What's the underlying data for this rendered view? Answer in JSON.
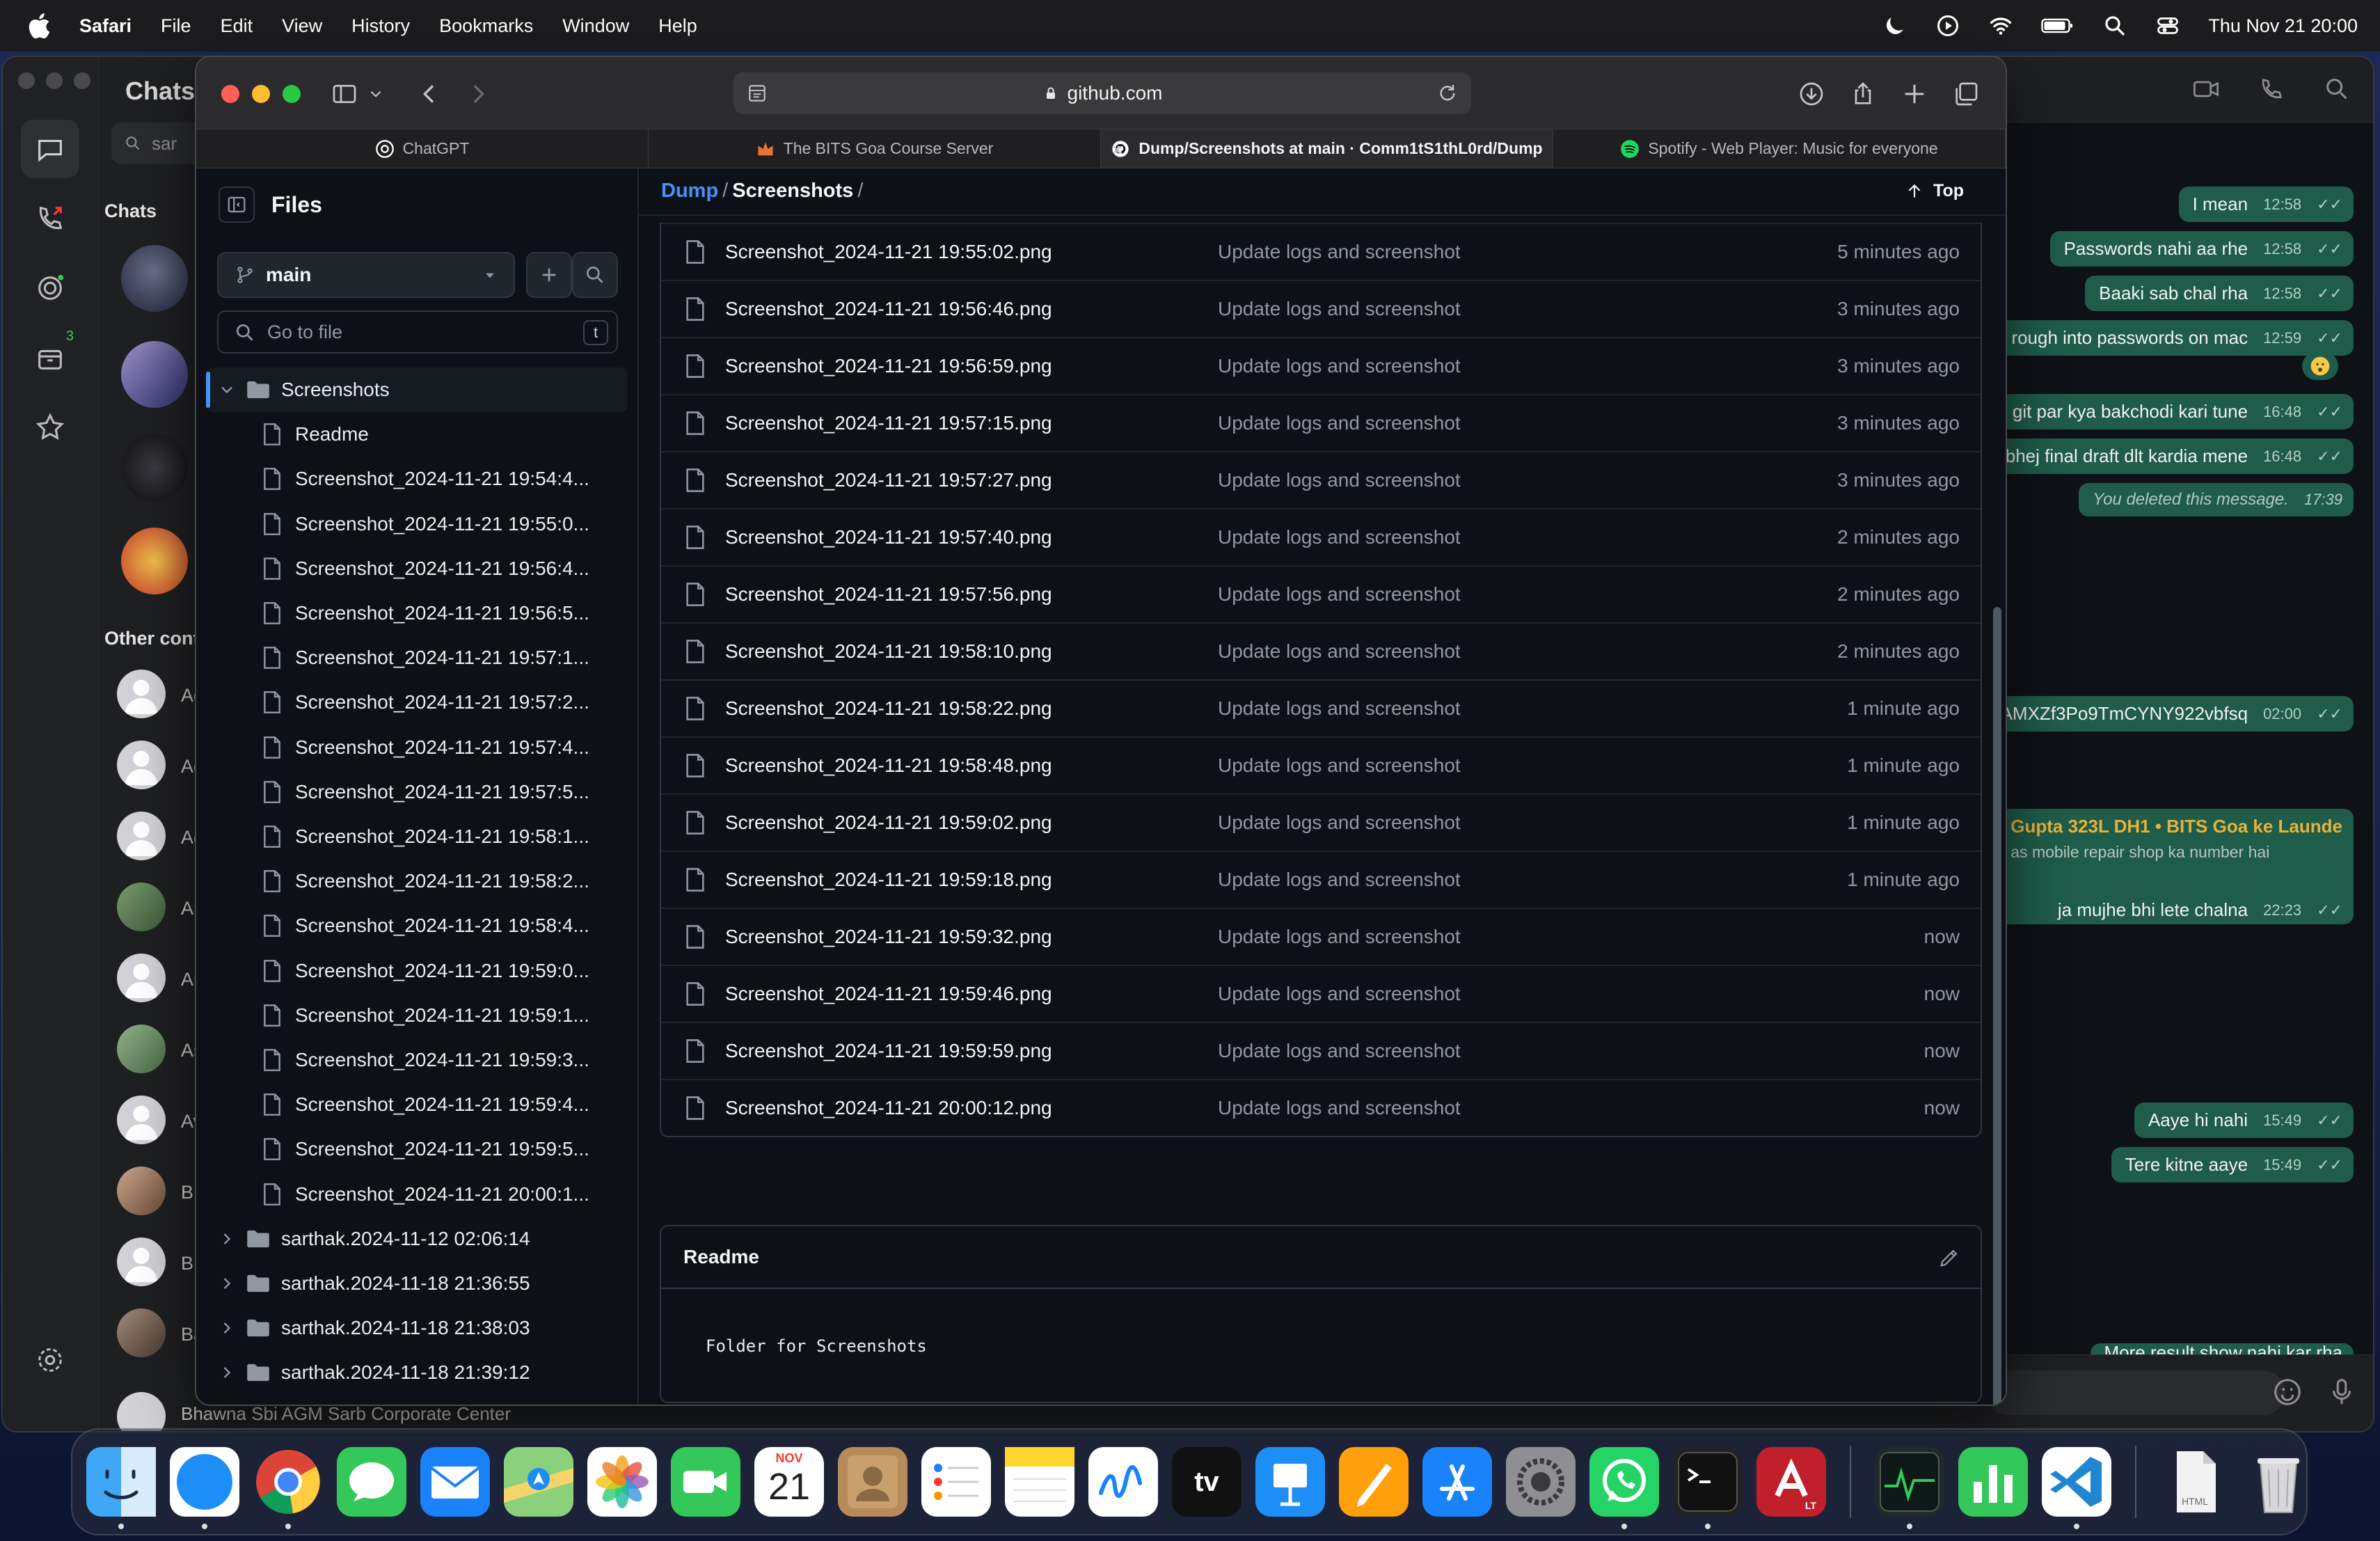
{
  "menubar": {
    "app": "Safari",
    "items": [
      "File",
      "Edit",
      "View",
      "History",
      "Bookmarks",
      "Window",
      "Help"
    ],
    "clock": "Thu Nov 21  20:00"
  },
  "whatsapp": {
    "title": "Chats",
    "search_text": "sar",
    "archived_badge": "3",
    "section_chats": "Chats",
    "section_other": "Other cont",
    "contacts": [
      "Ad",
      "Ad",
      "Ad",
      "An",
      "An",
      "As",
      "Av",
      "B",
      "B",
      "Ba"
    ],
    "bottom_contact": "Bhawna Sbi AGM Sarb Corporate Center",
    "messages": [
      {
        "text": "I mean",
        "time": "12:58",
        "ticks": "✓✓"
      },
      {
        "text": "Passwords nahi aa rhe",
        "time": "12:58",
        "ticks": "✓✓"
      },
      {
        "text": "Baaki sab chal rha",
        "time": "12:58",
        "ticks": "✓✓"
      },
      {
        "text": "rough into passwords on mac",
        "time": "12:59",
        "ticks": "✓✓"
      },
      {
        "text": "git par kya bakchodi kari tune",
        "time": "16:48",
        "ticks": "✓✓"
      },
      {
        "text": "bhej final draft dlt kardia mene",
        "time": "16:48",
        "ticks": "✓✓"
      },
      {
        "text": "You deleted this message.",
        "time": "17:39",
        "ticks": ""
      },
      {
        "text": "AMXZf3Po9TmCYNY922vbfsq",
        "time": "02:00",
        "ticks": "✓✓"
      },
      {
        "text": "ja mujhe bhi lete chalna",
        "time": "22:23",
        "ticks": "✓✓"
      },
      {
        "text": "Aaye hi nahi",
        "time": "15:49",
        "ticks": "✓✓"
      },
      {
        "text": "Tere kitne aaye",
        "time": "15:49",
        "ticks": "✓✓"
      },
      {
        "text": "More result show nahi kar rha",
        "time": "",
        "ticks": ""
      }
    ],
    "group_msg": {
      "sender": "Gupta 323L DH1 • BITS Goa ke Launde",
      "sub": "as mobile repair shop ka number hai"
    }
  },
  "safari": {
    "url": "github.com",
    "tabs": [
      {
        "label": "ChatGPT",
        "favicon_color": "#ffffff"
      },
      {
        "label": "The BITS Goa Course Server",
        "favicon_color": "#e8743b"
      },
      {
        "label": "Dump/Screenshots at main · Comm1tS1thL0rd/Dump",
        "favicon_color": "#ffffff"
      },
      {
        "label": "Spotify - Web Player: Music for everyone",
        "favicon_color": "#1ed760"
      }
    ]
  },
  "github": {
    "files_title": "Files",
    "branch": "main",
    "goto_placeholder": "Go to file",
    "goto_kbd": "t",
    "tree": {
      "folder": "Screenshots",
      "items": [
        "Readme",
        "Screenshot_2024-11-21 19:54:4...",
        "Screenshot_2024-11-21 19:55:0...",
        "Screenshot_2024-11-21 19:56:4...",
        "Screenshot_2024-11-21 19:56:5...",
        "Screenshot_2024-11-21 19:57:1...",
        "Screenshot_2024-11-21 19:57:2...",
        "Screenshot_2024-11-21 19:57:4...",
        "Screenshot_2024-11-21 19:57:5...",
        "Screenshot_2024-11-21 19:58:1...",
        "Screenshot_2024-11-21 19:58:2...",
        "Screenshot_2024-11-21 19:58:4...",
        "Screenshot_2024-11-21 19:59:0...",
        "Screenshot_2024-11-21 19:59:1...",
        "Screenshot_2024-11-21 19:59:3...",
        "Screenshot_2024-11-21 19:59:4...",
        "Screenshot_2024-11-21 19:59:5...",
        "Screenshot_2024-11-21 20:00:1..."
      ],
      "other_folders": [
        "sarthak.2024-11-12 02:06:14",
        "sarthak.2024-11-18 21:36:55",
        "sarthak.2024-11-18 21:38:03",
        "sarthak.2024-11-18 21:39:12"
      ]
    },
    "breadcrumb": {
      "repo": "Dump",
      "sep": "/",
      "folder": "Screenshots",
      "trail": "/"
    },
    "top_label": "Top",
    "files": [
      {
        "name": "Screenshot_2024-11-21 19:55:02.png",
        "commit": "Update logs and screenshot",
        "age": "5 minutes ago"
      },
      {
        "name": "Screenshot_2024-11-21 19:56:46.png",
        "commit": "Update logs and screenshot",
        "age": "3 minutes ago"
      },
      {
        "name": "Screenshot_2024-11-21 19:56:59.png",
        "commit": "Update logs and screenshot",
        "age": "3 minutes ago"
      },
      {
        "name": "Screenshot_2024-11-21 19:57:15.png",
        "commit": "Update logs and screenshot",
        "age": "3 minutes ago"
      },
      {
        "name": "Screenshot_2024-11-21 19:57:27.png",
        "commit": "Update logs and screenshot",
        "age": "3 minutes ago"
      },
      {
        "name": "Screenshot_2024-11-21 19:57:40.png",
        "commit": "Update logs and screenshot",
        "age": "2 minutes ago"
      },
      {
        "name": "Screenshot_2024-11-21 19:57:56.png",
        "commit": "Update logs and screenshot",
        "age": "2 minutes ago"
      },
      {
        "name": "Screenshot_2024-11-21 19:58:10.png",
        "commit": "Update logs and screenshot",
        "age": "2 minutes ago"
      },
      {
        "name": "Screenshot_2024-11-21 19:58:22.png",
        "commit": "Update logs and screenshot",
        "age": "1 minute ago"
      },
      {
        "name": "Screenshot_2024-11-21 19:58:48.png",
        "commit": "Update logs and screenshot",
        "age": "1 minute ago"
      },
      {
        "name": "Screenshot_2024-11-21 19:59:02.png",
        "commit": "Update logs and screenshot",
        "age": "1 minute ago"
      },
      {
        "name": "Screenshot_2024-11-21 19:59:18.png",
        "commit": "Update logs and screenshot",
        "age": "1 minute ago"
      },
      {
        "name": "Screenshot_2024-11-21 19:59:32.png",
        "commit": "Update logs and screenshot",
        "age": "now"
      },
      {
        "name": "Screenshot_2024-11-21 19:59:46.png",
        "commit": "Update logs and screenshot",
        "age": "now"
      },
      {
        "name": "Screenshot_2024-11-21 19:59:59.png",
        "commit": "Update logs and screenshot",
        "age": "now"
      },
      {
        "name": "Screenshot_2024-11-21 20:00:12.png",
        "commit": "Update logs and screenshot",
        "age": "now"
      }
    ],
    "readme": {
      "title": "Readme",
      "body": "Folder for Screenshots"
    }
  },
  "dock": {
    "calendar_month": "NOV",
    "calendar_day": "21",
    "apps": [
      "finder-icon",
      "safari-icon",
      "chrome-icon",
      "messages-icon",
      "mail-icon",
      "maps-icon",
      "photos-icon",
      "facetime-icon",
      "calendar-icon",
      "contacts-icon",
      "reminders-icon",
      "notes-icon",
      "freeform-icon",
      "tv-icon",
      "keynote-icon",
      "pages-icon",
      "app-store-icon",
      "system-settings-icon",
      "whatsapp-icon",
      "terminal-icon",
      "autocad-icon",
      "activity-monitor-icon",
      "numbers-icon",
      "vscode-icon",
      "html-file-icon",
      "trash-icon"
    ],
    "tv_label": "tv",
    "html_label": "HTML",
    "autocad_badge": "LT"
  }
}
